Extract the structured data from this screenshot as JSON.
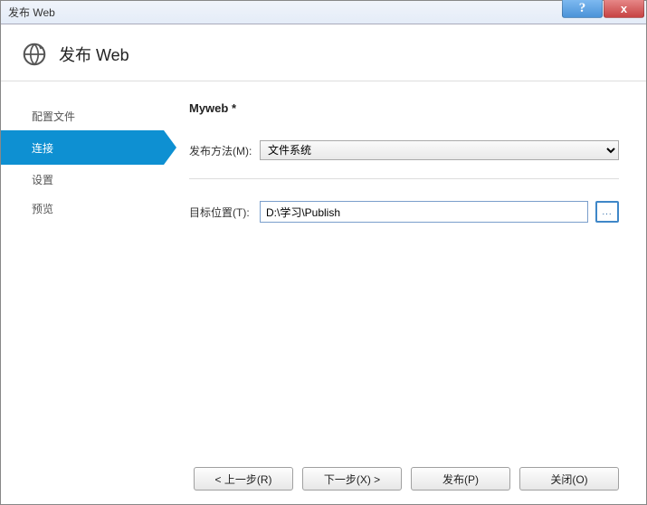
{
  "window": {
    "title": "发布 Web",
    "help_symbol": "?",
    "close_symbol": "x"
  },
  "header": {
    "title": "发布 Web"
  },
  "sidebar": {
    "items": [
      {
        "label": "配置文件",
        "active": false
      },
      {
        "label": "连接",
        "active": true
      },
      {
        "label": "设置",
        "active": false
      },
      {
        "label": "预览",
        "active": false
      }
    ]
  },
  "content": {
    "profile_name": "Myweb *",
    "publish_method_label": "发布方法(M):",
    "publish_method_value": "文件系统",
    "target_label": "目标位置(T):",
    "target_value": "D:\\学习\\Publish",
    "browse_symbol": "..."
  },
  "footer": {
    "prev": "< 上一步(R)",
    "next": "下一步(X) >",
    "publish": "发布(P)",
    "close": "关闭(O)"
  }
}
